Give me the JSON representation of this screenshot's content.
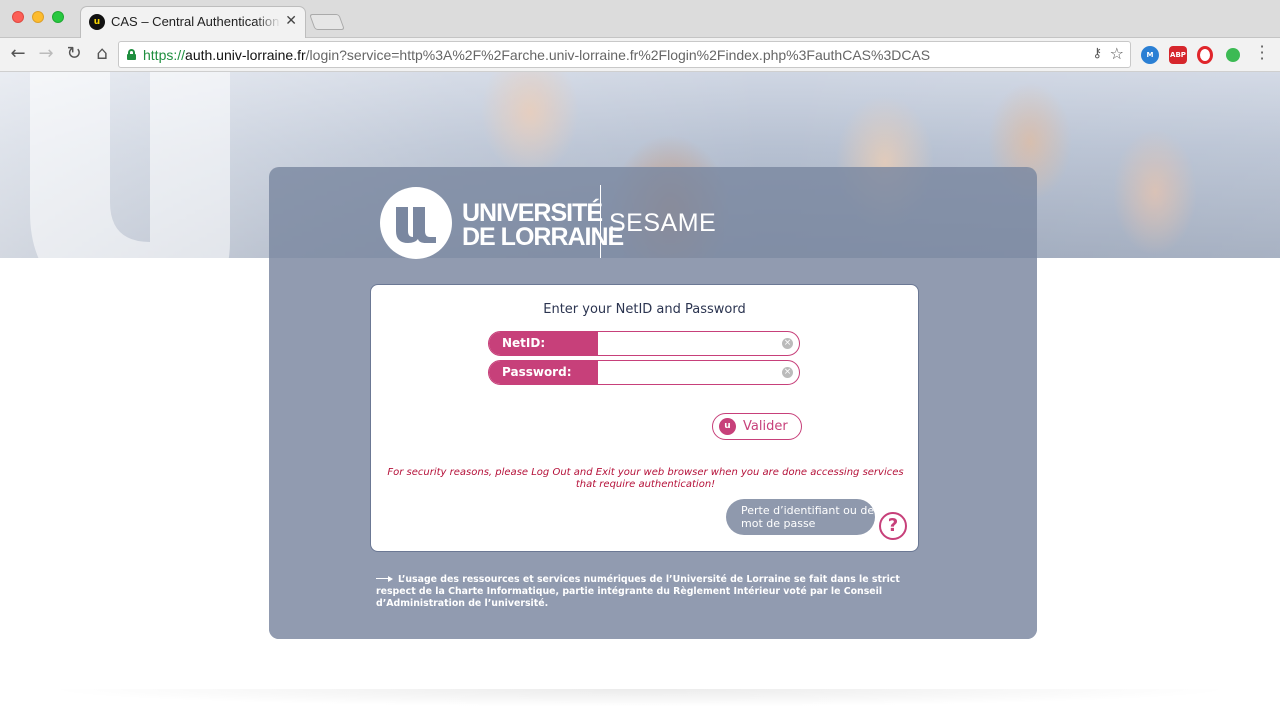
{
  "browser": {
    "tab": {
      "title": "CAS – Central Authentication Service",
      "favicon_text": "u",
      "close": "✕"
    },
    "nav": {
      "back": "←",
      "forward": "→",
      "reload": "↻",
      "home": "⌂"
    },
    "address": {
      "scheme": "https://",
      "host": "auth.univ-lorraine.fr",
      "path": "/login?service=http%3A%2F%2Farche.univ-lorraine.fr%2Flogin%2Findex.php%3FauthCAS%3DCAS"
    },
    "extensions": {
      "ext1": "M",
      "abp": "ABP",
      "opera": "",
      "green": ""
    },
    "icons": [
      "back-icon",
      "forward-icon",
      "reload-icon",
      "home-icon",
      "lock-icon",
      "key-icon",
      "star-icon",
      "menu-icon"
    ]
  },
  "header": {
    "logo_line1": "UNIVERSITÉ",
    "logo_line2": "DE LORRAINE",
    "app_name": "SESAME"
  },
  "login": {
    "title": "Enter your NetID and Password",
    "netid_label": "NetID:",
    "netid_value": "",
    "password_label": "Password:",
    "password_value": "",
    "submit_label": "Valider",
    "submit_icon": "u",
    "security_note": "For security reasons, please Log Out and Exit your web browser when you are done accessing services that require authentication!",
    "help_text": "Perte d’identifiant ou de mot de passe",
    "help_icon": "?"
  },
  "footer": {
    "charter": "L’usage des ressources et services numériques de l’Université de Lorraine se fait dans le strict respect de la Charte Informatique, partie intégrante du Règlement Intérieur voté par le Conseil d’Administration de l’université."
  },
  "colors": {
    "accent": "#c7407a",
    "panel": "#919bb0",
    "warning": "#b5123a"
  }
}
